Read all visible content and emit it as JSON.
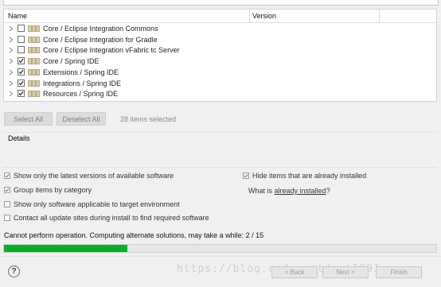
{
  "table": {
    "columns": [
      "Name",
      "Version"
    ],
    "rows": [
      {
        "label": "Core / Eclipse Integration Commons",
        "checked": false
      },
      {
        "label": "Core / Eclipse Integration for Gradle",
        "checked": false
      },
      {
        "label": "Core / Eclipse Integration vFabric tc Server",
        "checked": false
      },
      {
        "label": "Core / Spring IDE",
        "checked": true
      },
      {
        "label": "Extensions / Spring IDE",
        "checked": true
      },
      {
        "label": "Integrations / Spring IDE",
        "checked": true
      },
      {
        "label": "Resources / Spring IDE",
        "checked": true
      }
    ]
  },
  "buttons": {
    "select_all": "Select All",
    "deselect_all": "Deselect All",
    "selection_count": "28 items selected"
  },
  "details": {
    "title": "Details"
  },
  "options": {
    "latest_versions": {
      "label": "Show only the latest versions of available software",
      "checked": true
    },
    "group_by_category": {
      "label": "Group items by category",
      "checked": true
    },
    "target_env": {
      "label": "Show only software applicable to target environment",
      "checked": false
    },
    "contact_sites": {
      "label": "Contact all update sites during install to find required software",
      "checked": false
    },
    "hide_installed": {
      "label": "Hide items that are already installed",
      "checked": true
    },
    "what_is_prefix": "What is ",
    "what_is_link": "already installed",
    "what_is_suffix": "?"
  },
  "status": {
    "text": "Cannot perform operation. Computing alternate solutions, may take a while: 2 / 15",
    "progress_fraction": 0.286
  },
  "footer": {
    "help": "?",
    "back": "< Back",
    "next": "Next >",
    "finish": "Finish",
    "watermark": "https://blog.csdn.net/wei1991"
  },
  "colors": {
    "progress": "#06b025",
    "checkbox_border": "#6e6e6e"
  }
}
